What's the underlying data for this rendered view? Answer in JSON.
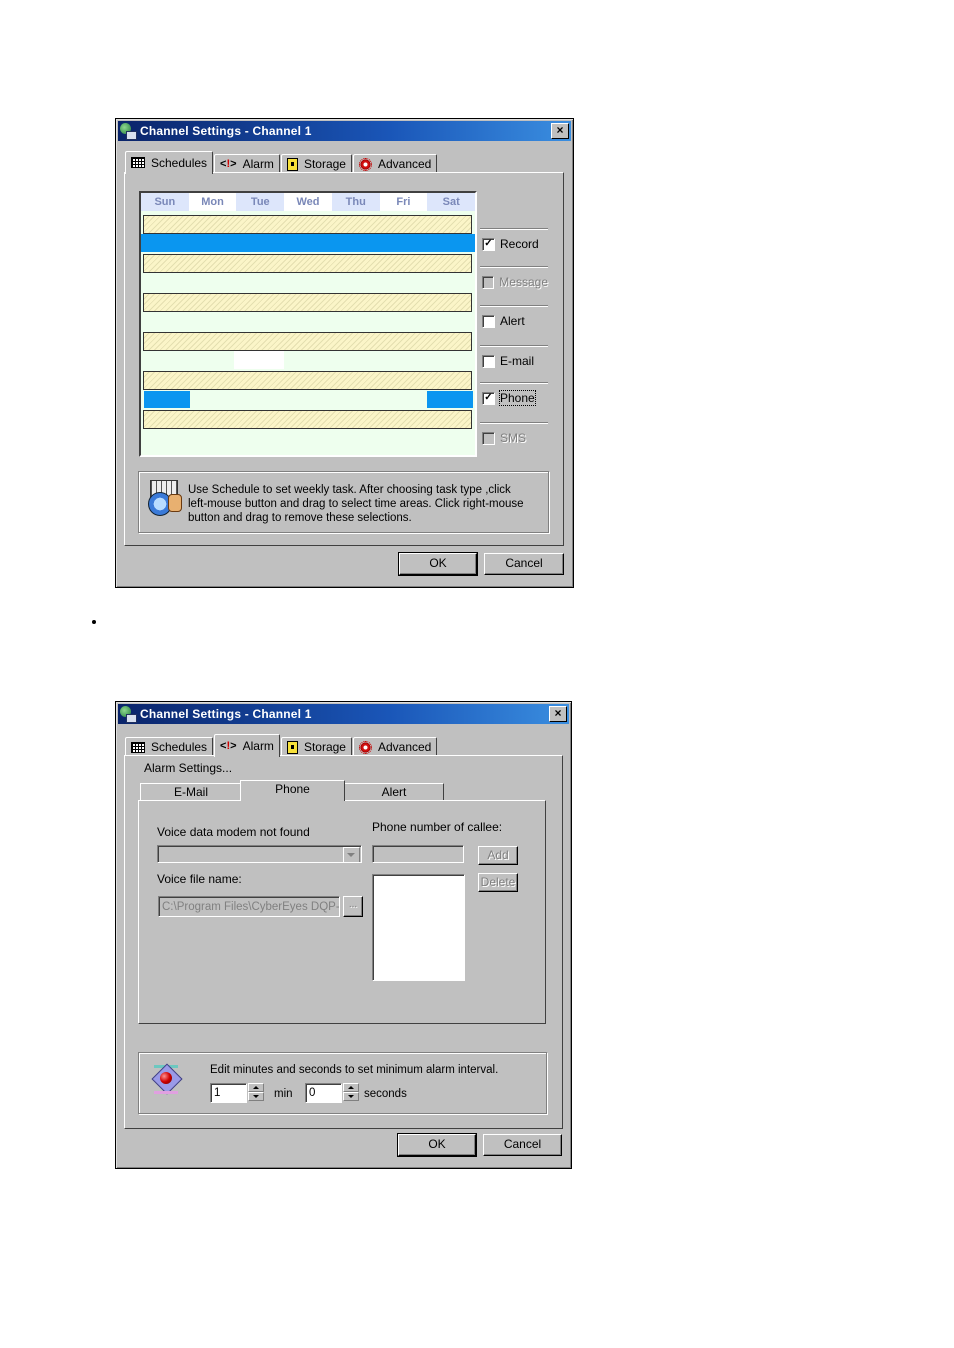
{
  "bullet_marker": "•",
  "dialog1": {
    "title": "Channel Settings  -   Channel 1",
    "close_glyph": "×",
    "tabs": [
      {
        "label": "Schedules",
        "icon": "grid-icon",
        "active": true
      },
      {
        "label": "Alarm",
        "icon": "alarm-icon",
        "active": false
      },
      {
        "label": "Storage",
        "icon": "storage-icon",
        "active": false
      },
      {
        "label": "Advanced",
        "icon": "gear-icon",
        "active": false
      }
    ],
    "schedule": {
      "days": [
        "Sun",
        "Mon",
        "Tue",
        "Wed",
        "Thu",
        "Fri",
        "Sat"
      ],
      "rows": [
        {
          "type": "Record",
          "pattern": "hatch"
        },
        {
          "type": "Record",
          "pattern": "full-selected",
          "color": "#0a96f0"
        },
        {
          "type": "Message",
          "pattern": "hatch"
        },
        {
          "type": "Message",
          "pattern": "empty"
        },
        {
          "type": "Alert",
          "pattern": "hatch"
        },
        {
          "type": "Alert",
          "pattern": "empty"
        },
        {
          "type": "E-mail",
          "pattern": "hatch"
        },
        {
          "type": "E-mail",
          "pattern": "partial-white-tue"
        },
        {
          "type": "Phone",
          "pattern": "hatch"
        },
        {
          "type": "Phone",
          "pattern": "sun-sat-selected",
          "color": "#0a96f0"
        },
        {
          "type": "SMS",
          "pattern": "hatch"
        },
        {
          "type": "SMS",
          "pattern": "empty"
        }
      ]
    },
    "task_types": [
      {
        "label": "Record",
        "checked": true,
        "enabled": true,
        "focused": false
      },
      {
        "label": "Message",
        "checked": false,
        "enabled": false,
        "focused": false
      },
      {
        "label": "Alert",
        "checked": false,
        "enabled": true,
        "focused": false
      },
      {
        "label": "E-mail",
        "checked": false,
        "enabled": true,
        "focused": false
      },
      {
        "label": "Phone",
        "checked": true,
        "enabled": true,
        "focused": true
      },
      {
        "label": "SMS",
        "checked": false,
        "enabled": false,
        "focused": false
      }
    ],
    "info_lines": [
      "Use Schedule to set weekly task. After choosing task type ,click",
      "left-mouse  button and drag to select time areas. Click right-mouse",
      "button and drag to remove these selections."
    ],
    "ok_label": "OK",
    "cancel_label": "Cancel",
    "check_glyph": "✓"
  },
  "dialog2": {
    "title": "Channel Settings  -   Channel 1",
    "close_glyph": "×",
    "tabs": [
      {
        "label": "Schedules",
        "icon": "grid-icon",
        "active": false
      },
      {
        "label": "Alarm",
        "icon": "alarm-icon",
        "active": true
      },
      {
        "label": "Storage",
        "icon": "storage-icon",
        "active": false
      },
      {
        "label": "Advanced",
        "icon": "gear-icon",
        "active": false
      }
    ],
    "section_label": "Alarm Settings...",
    "subtabs": [
      {
        "label": "E-Mail",
        "active": false
      },
      {
        "label": "Phone",
        "active": true
      },
      {
        "label": "Alert",
        "active": false
      }
    ],
    "modem_label": "Voice data modem not found",
    "modem_value": "",
    "voice_file_label": "Voice file name:",
    "voice_file_value": "C:\\Program Files\\CyberEyes DQP-",
    "browse_label": "...",
    "phone_label": "Phone number of callee:",
    "phone_value": "",
    "add_label": "Add",
    "delete_label": "Delete",
    "phone_list": [],
    "interval_text": "Edit minutes and seconds to set minimum alarm interval.",
    "minutes_value": "1",
    "minutes_unit": "min",
    "seconds_value": "0",
    "seconds_unit": "seconds",
    "ok_label": "OK",
    "cancel_label": "Cancel"
  }
}
